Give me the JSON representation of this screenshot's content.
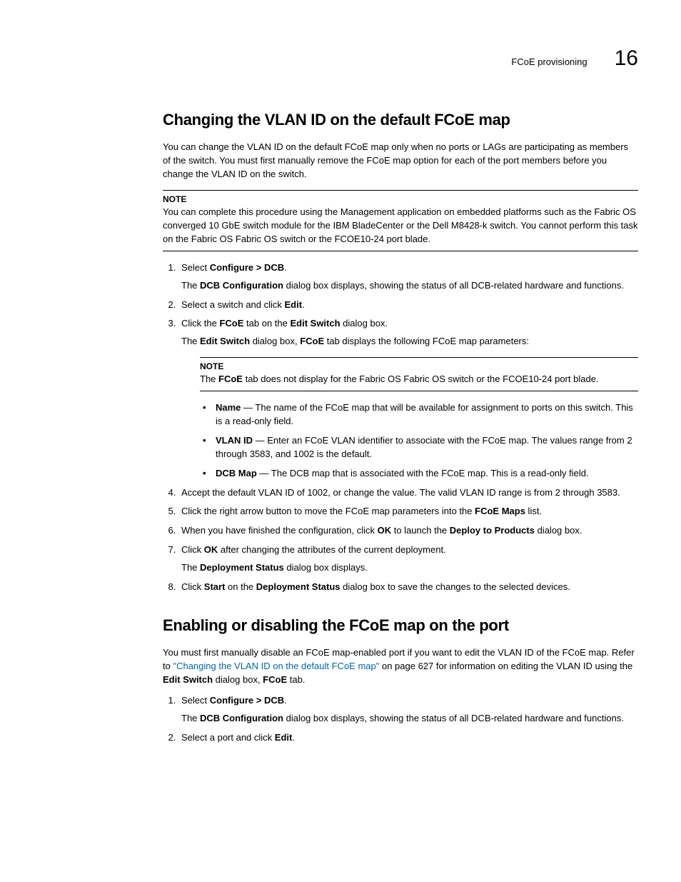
{
  "header": {
    "label": "FCoE provisioning",
    "chapter": "16"
  },
  "section1": {
    "title": "Changing the VLAN ID on the default FCoE map",
    "intro": "You can change the VLAN ID on the default FCoE map only when no ports or LAGs are participating as members of the switch. You must first manually remove the FCoE map option for each of the port members before you change the VLAN ID on the switch.",
    "note": {
      "title": "NOTE",
      "body": "You can complete this procedure using the Management application on embedded platforms such as the Fabric OS converged 10 GbE switch module for the IBM BladeCenter or the Dell M8428-k switch. You cannot perform this task on the Fabric OS Fabric OS switch or the FCOE10-24 port blade."
    },
    "steps": {
      "s1_a": "Select ",
      "s1_b": "Configure > DCB",
      "s1_c": ".",
      "s1_sub_a": "The ",
      "s1_sub_b": "DCB Configuration",
      "s1_sub_c": " dialog box displays, showing the status of all DCB-related hardware and functions.",
      "s2_a": "Select a switch and click ",
      "s2_b": "Edit",
      "s2_c": ".",
      "s3_a": "Click the ",
      "s3_b": "FCoE",
      "s3_c": " tab on the ",
      "s3_d": "Edit Switch",
      "s3_e": " dialog box.",
      "s3_sub_a": "The ",
      "s3_sub_b": "Edit Switch",
      "s3_sub_c": " dialog box, ",
      "s3_sub_d": "FCoE",
      "s3_sub_e": " tab displays the following FCoE map parameters:",
      "s3_note_title": "NOTE",
      "s3_note_a": "The ",
      "s3_note_b": "FCoE",
      "s3_note_c": " tab does not display for the Fabric OS Fabric OS switch or the FCOE10-24 port blade.",
      "b1_a": "Name",
      "b1_b": " — The name of the FCoE map that will be available for assignment to ports on this switch. This is a read-only field.",
      "b2_a": "VLAN ID",
      "b2_b": " — Enter an FCoE VLAN identifier to associate with the FCoE map. The values range from 2 through 3583, and 1002 is the default.",
      "b3_a": "DCB Map",
      "b3_b": " — The DCB map that is associated with the FCoE map. This is a read-only field.",
      "s4": "Accept the default VLAN ID of 1002, or change the value. The valid VLAN ID range is from 2 through 3583.",
      "s5_a": "Click the right arrow button to move the FCoE map parameters into the ",
      "s5_b": "FCoE Maps",
      "s5_c": " list.",
      "s6_a": "When you have finished the configuration, click ",
      "s6_b": "OK",
      "s6_c": " to launch the ",
      "s6_d": "Deploy to Products",
      "s6_e": " dialog box.",
      "s7_a": "Click ",
      "s7_b": "OK",
      "s7_c": " after changing the attributes of the current deployment.",
      "s7_sub_a": "The ",
      "s7_sub_b": "Deployment Status",
      "s7_sub_c": " dialog box displays.",
      "s8_a": "Click ",
      "s8_b": "Start",
      "s8_c": " on the ",
      "s8_d": "Deployment Status",
      "s8_e": " dialog box to save the changes to the selected devices."
    }
  },
  "section2": {
    "title": "Enabling or disabling the FCoE map on the port",
    "intro_a": "You must first manually disable an FCoE map-enabled port if you want to edit the VLAN ID of the FCoE map. Refer to ",
    "intro_link": "\"Changing the VLAN ID on the default FCoE map\"",
    "intro_b": " on page 627 for information on editing the VLAN ID using the ",
    "intro_c": "Edit Switch",
    "intro_d": " dialog box, ",
    "intro_e": "FCoE",
    "intro_f": " tab.",
    "steps": {
      "s1_a": "Select ",
      "s1_b": "Configure > DCB",
      "s1_c": ".",
      "s1_sub_a": "The ",
      "s1_sub_b": "DCB Configuration",
      "s1_sub_c": " dialog box displays, showing the status of all DCB-related hardware and functions.",
      "s2_a": "Select a port and click ",
      "s2_b": "Edit",
      "s2_c": "."
    }
  }
}
